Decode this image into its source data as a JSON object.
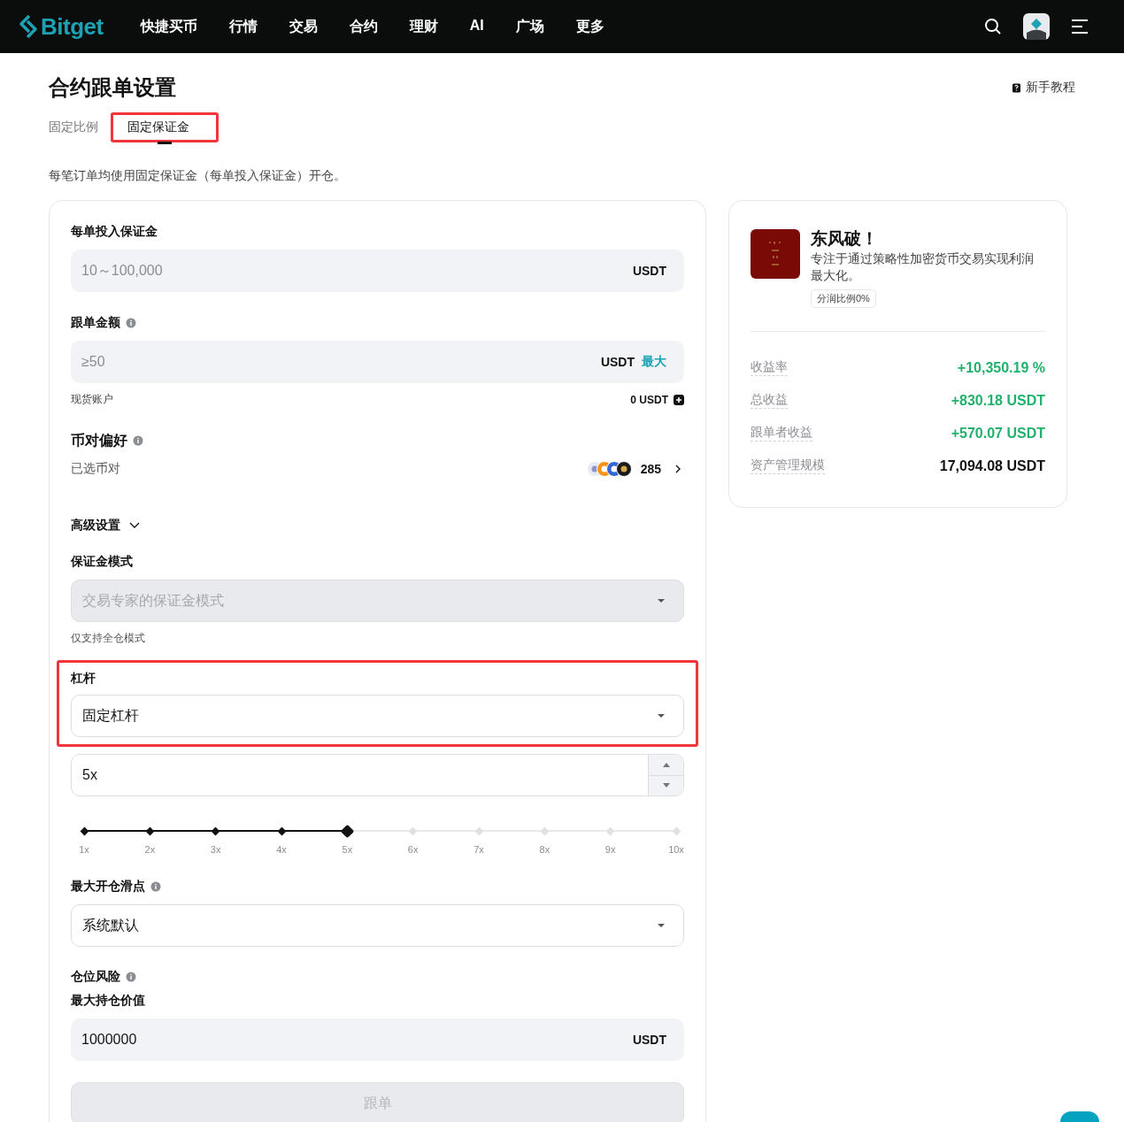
{
  "nav": {
    "logo": "Bitget",
    "items": [
      "快捷买币",
      "行情",
      "交易",
      "合约",
      "理财",
      "AI",
      "广场",
      "更多"
    ]
  },
  "page": {
    "title": "合约跟单设置",
    "help_link": "新手教程",
    "description": "每笔订单均使用固定保证金（每单投入保证金）开仓。"
  },
  "tabs": [
    {
      "label": "固定比例",
      "selected": false,
      "highlighted": false
    },
    {
      "label": "固定保证金",
      "selected": true,
      "highlighted": true
    }
  ],
  "form": {
    "margin_field": {
      "label": "每单投入保证金",
      "placeholder": "10～100,000",
      "unit": "USDT"
    },
    "amount_field": {
      "label": "跟单金额",
      "placeholder": "≥50",
      "unit": "USDT",
      "max_label": "最大"
    },
    "spot_account": {
      "label": "现货账户",
      "value": "0 USDT"
    },
    "pair_preference": {
      "label": "币对偏好",
      "selected_label": "已选币对",
      "count": "285"
    },
    "advanced": {
      "label": "高级设置"
    },
    "margin_mode": {
      "label": "保证金模式",
      "placeholder": "交易专家的保证金模式",
      "disabled": true,
      "note": "仅支持全仓模式"
    },
    "leverage": {
      "label": "杠杆",
      "value": "固定杠杆",
      "highlighted": true
    },
    "leverage_input": {
      "value": "5x"
    },
    "leverage_slider": {
      "level": 0.4444,
      "marks": [
        "1x",
        "2x",
        "3x",
        "4x",
        "5x",
        "6x",
        "7x",
        "8x",
        "9x",
        "10x"
      ]
    },
    "slippage": {
      "label": "最大开仓滑点",
      "value": "系统默认"
    },
    "position_risk": {
      "label": "仓位风险"
    },
    "max_position": {
      "label": "最大持仓价值",
      "value": "1000000",
      "unit": "USDT"
    },
    "submit": {
      "label": "跟单",
      "disabled": true
    }
  },
  "trader": {
    "name": "东风破！",
    "bio": "专注于通过策略性加密货币交易实现利润最大化。",
    "tag": "分润比例0%",
    "stats": [
      {
        "label": "收益率",
        "value": "+10,350.19 %",
        "color": "#20b26c"
      },
      {
        "label": "总收益",
        "value": "+830.18 USDT",
        "color": "#20b26c"
      },
      {
        "label": "跟单者收益",
        "value": "+570.07 USDT",
        "color": "#20b26c"
      },
      {
        "label": "资产管理规模",
        "value": "17,094.08 USDT",
        "color": "#121212"
      }
    ]
  }
}
